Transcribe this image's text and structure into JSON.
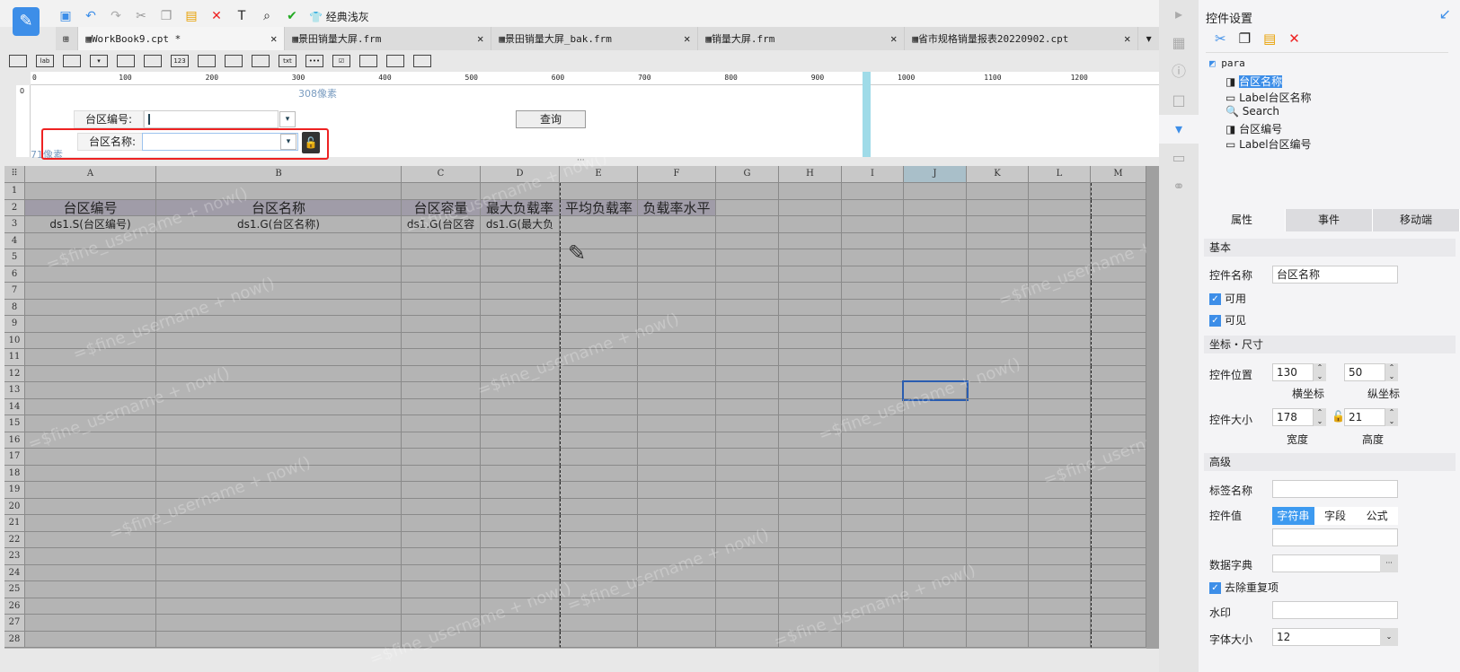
{
  "toolbar": {
    "theme_label": "经典浅灰"
  },
  "tabs": [
    {
      "label": "WorkBook9.cpt *",
      "active": true
    },
    {
      "label": "景田销量大屏.frm"
    },
    {
      "label": "景田销量大屏_bak.frm"
    },
    {
      "label": "销量大屏.frm"
    },
    {
      "label": "省市规格销量报表20220902.cpt"
    }
  ],
  "widget_toolbar": [
    "",
    "lab",
    "",
    "▾",
    "",
    "",
    "123",
    "",
    "",
    "",
    "txt",
    "•••",
    "☑",
    "",
    "",
    ""
  ],
  "ruler": {
    "ticks": [
      "0",
      "100",
      "200",
      "300",
      "400",
      "500",
      "600",
      "700",
      "800",
      "900",
      "1000",
      "1100",
      "1200"
    ],
    "width_hint": "308像素",
    "height_hint": "71像素",
    "v0": "0"
  },
  "param_form": {
    "label1": "台区编号:",
    "label2": "台区名称:",
    "query_button": "查询"
  },
  "grid": {
    "columns": [
      "A",
      "B",
      "C",
      "D",
      "E",
      "F",
      "G",
      "H",
      "I",
      "J",
      "K",
      "L",
      "M"
    ],
    "row_count": 28,
    "headers": [
      "台区编号",
      "台区名称",
      "台区容量",
      "最大负载率",
      "平均负载率",
      "负载率水平"
    ],
    "row3": [
      "ds1.S(台区编号)",
      "ds1.G(台区名称)",
      "ds1.G(台区容",
      "ds1.G(最大负"
    ],
    "watermark": "=$fine_username + now()",
    "selected_cell": "J13"
  },
  "panel": {
    "title": "控件设置",
    "tree": {
      "root": "para",
      "items": [
        "台区名称",
        "Label台区名称",
        "Search",
        "台区编号",
        "Label台区编号"
      ],
      "selected": 0
    },
    "tabs": [
      "属性",
      "事件",
      "移动端"
    ],
    "basic": "基本",
    "name_label": "控件名称",
    "name_value": "台区名称",
    "enabled": "可用",
    "visible": "可见",
    "coord": "坐标・尺寸",
    "pos_label": "控件位置",
    "x": "130",
    "y": "50",
    "x_label": "横坐标",
    "y_label": "纵坐标",
    "size_label": "控件大小",
    "w": "178",
    "h": "21",
    "w_label": "宽度",
    "h_label": "高度",
    "advanced": "高级",
    "tag_label": "标签名称",
    "value_label": "控件值",
    "value_types": [
      "字符串",
      "字段",
      "公式"
    ],
    "dict_label": "数据字典",
    "dedupe": "去除重复项",
    "watermark_label": "水印",
    "fontsize_label": "字体大小",
    "fontsize": "12"
  }
}
